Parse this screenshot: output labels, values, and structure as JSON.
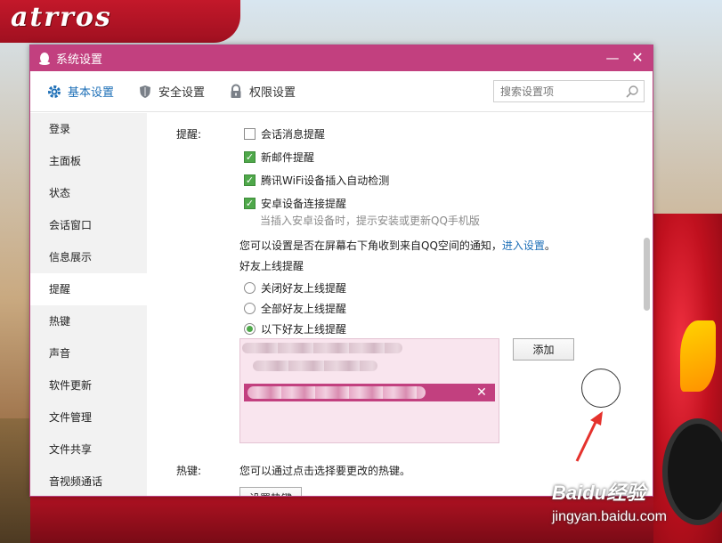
{
  "wallpaper": {
    "logo_text": "atrros",
    "watermark_brand": "Baidu经验",
    "watermark_url": "jingyan.baidu.com"
  },
  "window": {
    "title": "系统设置",
    "minimize_glyph": "—",
    "close_glyph": "✕"
  },
  "tabs": [
    {
      "label": "基本设置",
      "icon": "gear-icon",
      "active": true
    },
    {
      "label": "安全设置",
      "icon": "shield-icon",
      "active": false
    },
    {
      "label": "权限设置",
      "icon": "lock-icon",
      "active": false
    }
  ],
  "search": {
    "placeholder": "搜索设置项"
  },
  "sidebar": {
    "items": [
      {
        "label": "登录"
      },
      {
        "label": "主面板"
      },
      {
        "label": "状态"
      },
      {
        "label": "会话窗口"
      },
      {
        "label": "信息展示"
      },
      {
        "label": "提醒",
        "active": true
      },
      {
        "label": "热键"
      },
      {
        "label": "声音"
      },
      {
        "label": "软件更新"
      },
      {
        "label": "文件管理"
      },
      {
        "label": "文件共享"
      },
      {
        "label": "音视频通话"
      }
    ]
  },
  "reminder": {
    "section_label": "提醒:",
    "checkboxes": [
      {
        "label": "会话消息提醒",
        "checked": false
      },
      {
        "label": "新邮件提醒",
        "checked": true
      },
      {
        "label": "腾讯WiFi设备插入自动检测",
        "checked": true
      },
      {
        "label": "安卓设备连接提醒",
        "checked": true
      }
    ],
    "android_hint": "当插入安卓设备时，提示安装或更新QQ手机版",
    "qzone_text": "您可以设置是否在屏幕右下角收到来自QQ空间的通知，",
    "qzone_link": "进入设置",
    "qzone_tail": "。",
    "friend_online_label": "好友上线提醒",
    "radios": [
      {
        "label": "关闭好友上线提醒",
        "selected": false
      },
      {
        "label": "全部好友上线提醒",
        "selected": false
      },
      {
        "label": "以下好友上线提醒",
        "selected": true
      }
    ],
    "add_button": "添加",
    "remove_glyph": "✕",
    "check_glyph": "✓"
  },
  "hotkey": {
    "section_label": "热键:",
    "text": "您可以通过点击选择要更改的热键。",
    "button": "设置热键"
  },
  "colors": {
    "titlebar": "#c2407f",
    "accent_blue": "#1d6fb7",
    "check_green": "#4fa84a"
  }
}
